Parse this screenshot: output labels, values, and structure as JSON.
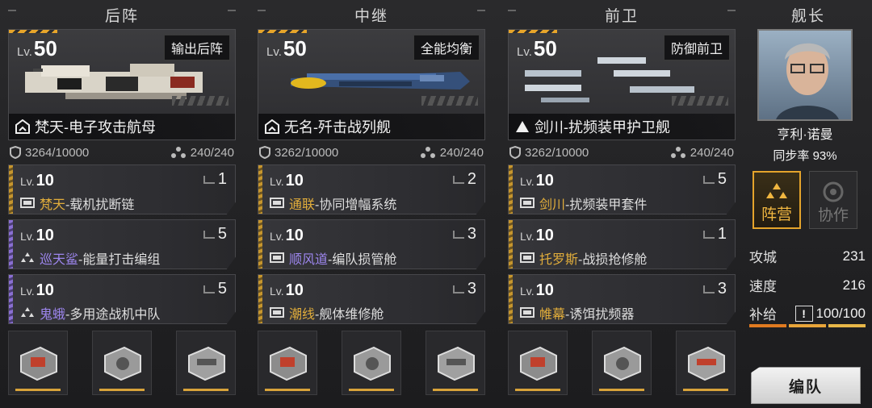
{
  "columns": [
    {
      "header": "后阵",
      "ship": {
        "lv_prefix": "Lv.",
        "lv": "50",
        "role": "输出后阵",
        "name": "梵天-电子攻击航母"
      },
      "stats": {
        "hp": "3264/10000",
        "load": "240/240"
      },
      "modules": [
        {
          "lv_prefix": "Lv.",
          "lv": "10",
          "count": "1",
          "hl": "梵天",
          "rest": "-载机扰断链",
          "color": "gold",
          "icon": "screen-icon"
        },
        {
          "lv_prefix": "Lv.",
          "lv": "10",
          "count": "5",
          "hl": "巡天鲨",
          "rest": "-能量打击编组",
          "color": "purple",
          "icon": "triangle-squad-icon"
        },
        {
          "lv_prefix": "Lv.",
          "lv": "10",
          "count": "5",
          "hl": "鬼蛾",
          "rest": "-多用途战机中队",
          "color": "purple",
          "icon": "triangle-squad-icon"
        }
      ]
    },
    {
      "header": "中继",
      "ship": {
        "lv_prefix": "Lv.",
        "lv": "50",
        "role": "全能均衡",
        "name": "无名-歼击战列舰"
      },
      "stats": {
        "hp": "3262/10000",
        "load": "240/240"
      },
      "modules": [
        {
          "lv_prefix": "Lv.",
          "lv": "10",
          "count": "2",
          "hl": "通联",
          "rest": "-协同增幅系统",
          "color": "gold",
          "icon": "screen-icon"
        },
        {
          "lv_prefix": "Lv.",
          "lv": "10",
          "count": "3",
          "hl": "顺风道",
          "rest": "-编队损管舱",
          "color": "gold",
          "icon": "screen-icon"
        },
        {
          "lv_prefix": "Lv.",
          "lv": "10",
          "count": "3",
          "hl": "潮线",
          "rest": "-舰体维修舱",
          "color": "gold",
          "icon": "screen-icon"
        }
      ]
    },
    {
      "header": "前卫",
      "ship": {
        "lv_prefix": "Lv.",
        "lv": "50",
        "role": "防御前卫",
        "name": "剑川-扰频装甲护卫舰"
      },
      "stats": {
        "hp": "3262/10000",
        "load": "240/240"
      },
      "modules": [
        {
          "lv_prefix": "Lv.",
          "lv": "10",
          "count": "5",
          "hl": "剑川",
          "rest": "-扰频装甲套件",
          "color": "gold",
          "icon": "screen-icon"
        },
        {
          "lv_prefix": "Lv.",
          "lv": "10",
          "count": "1",
          "hl": "托罗斯",
          "rest": "-战损抢修舱",
          "color": "gold",
          "icon": "screen-icon"
        },
        {
          "lv_prefix": "Lv.",
          "lv": "10",
          "count": "3",
          "hl": "帷幕",
          "rest": "-诱饵扰频器",
          "color": "gold",
          "icon": "screen-icon"
        }
      ]
    }
  ],
  "captain": {
    "header": "舰长",
    "name": "亨利·诺曼",
    "sync_label": "同步率",
    "sync_value": "93%",
    "camp_label": "阵营",
    "coop_label": "协作",
    "siege_label": "攻城",
    "siege_value": "231",
    "speed_label": "速度",
    "speed_value": "216",
    "supply_label": "补给",
    "supply_warn": "!",
    "supply_value": "100/100",
    "formation_button": "编队"
  },
  "colors": {
    "accent_gold": "#e1ad3b",
    "accent_purple": "#9d86ee",
    "supply_orange": "#e07a20"
  }
}
